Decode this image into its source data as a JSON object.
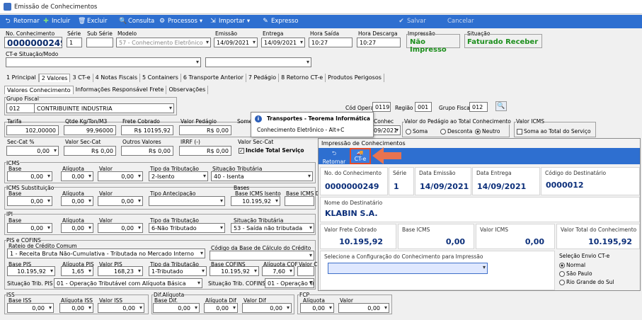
{
  "window": {
    "title": "Emissão de Conhecimentos"
  },
  "toolbar": {
    "retornar": "Retornar",
    "incluir": "Incluir",
    "excluir": "Excluir",
    "consulta": "Consulta",
    "processos": "Processos",
    "importar": "Importar",
    "expresso": "Expresso",
    "salvar": "Salvar",
    "cancelar": "Cancelar"
  },
  "header": {
    "no_conhecimento_label": "No. Conhecimento",
    "no_conhecimento": "0000000249",
    "serie_label": "Série",
    "serie": "1",
    "subserie_label": "Sub Série",
    "subserie": "",
    "modelo_label": "Modelo",
    "modelo": "57 - Conhecimento Eletrônico",
    "emissao_label": "Emissão",
    "emissao": "14/09/2021",
    "entrega_label": "Entrega",
    "entrega": "14/09/2021",
    "hora_saida_label": "Hora Saída",
    "hora_saida": "10:27",
    "hora_descarga_label": "Hora Descarga",
    "hora_descarga": "10:27",
    "impressao_label": "Impressão",
    "impressao": "Não Impresso",
    "situacao_label": "Situação",
    "situacao": "Faturado Receber",
    "cte_sit_label": "CT-e Situação/Modo"
  },
  "tabs": [
    "1 Principal",
    "2 Valores",
    "3 CT-e",
    "4 Notas Fiscais",
    "5 Containers",
    "6 Transporte Anterior",
    "7 Pedágio",
    "8 Retorno CT-e",
    "Produtos Perigosos"
  ],
  "subtabs": [
    "Valores Conhecimento",
    "Informações Responsável Frete",
    "Observações"
  ],
  "grupo": {
    "label": "Grupo Fiscal",
    "code": "012",
    "name": "CONTRIBUINTE INDUSTRIA",
    "cfo_label": "Cód Operação",
    "cfo": "0119",
    "regiao_label": "Região",
    "regiao": "001",
    "gf_label": "Grupo Fiscal",
    "gf": "012"
  },
  "valores": {
    "tarifa_label": "Tarifa",
    "tarifa": "102,00000",
    "qtde_label": "Qtde Kg/Ton/M3",
    "qtde": "99,96000",
    "frete_label": "Frete Cobrado",
    "frete": "R$ 10195,92",
    "pedagio_label": "Valor Pedágio",
    "pedagio": "R$ 0,00",
    "soma_label": "Some",
    "conhec_label": "Conhec",
    "conhec_date": "09/2021",
    "vpt_label": "Valor do Pedágio ao Total Conhecimento",
    "soma_opt": "Soma",
    "desconta_opt": "Desconta",
    "neutro_opt": "Neutro",
    "vicms_label": "Valor ICMS",
    "soma_total_opt": "Soma ao Total do Serviço",
    "seccat_label": "Sec-Cat %",
    "seccat": "0,00",
    "vsec_label": "Valor Sec-Cat",
    "vsec": "R$ 0,00",
    "outros_label": "Outros Valores",
    "outros": "R$ 0,00",
    "irrf_label": "IRRF (-)",
    "irrf": "R$ 0,00",
    "vsec2_label": "Valor Sec-Cat",
    "incide_label": "Incide Total Serviço"
  },
  "icms": {
    "title": "ICMS",
    "base_label": "Base",
    "base": "0,00",
    "aliq_label": "Alíquota",
    "aliq": "0,00",
    "valor_label": "Valor",
    "valor": "0,00",
    "trib_label": "Tipo da Tributação",
    "trib": "2-Isento",
    "sit_label": "Situação Tributária",
    "sit": "40 - Isenta"
  },
  "icms_st": {
    "title": "ICMS Substituição",
    "base_label": "Base",
    "base": "0,00",
    "aliq_label": "Alíquota",
    "aliq": "0,00",
    "valor_label": "Valor",
    "valor": "0,00",
    "antec_label": "Tipo Antecipação",
    "bases_label": "Bases",
    "isento_label": "Base ICMS Isento",
    "isento": "10.195,92",
    "def_label": "Base ICMS D"
  },
  "ipi": {
    "title": "IPI",
    "base_label": "Base",
    "base": "0,00",
    "aliq_label": "Alíquota",
    "aliq": "0,00",
    "valor_label": "Valor",
    "valor": "0,00",
    "trib_label": "Tipo da Tributação",
    "trib": "6-Não Tributado",
    "sit_label": "Situação Tributária",
    "sit": "53 - Saída não tributada"
  },
  "pis": {
    "title": "PIS e COFINS",
    "rateio_label": "Rateio de Crédito Comum",
    "rateio": "1 - Receita Bruta Não-Cumulativa - Tributada no Mercado Interno",
    "cod_base_label": "Código da Base de Cálculo do Crédito",
    "base_label": "Base PIS",
    "base": "10.195,92",
    "aliq_label": "Alíquota PIS",
    "aliq": "1,65",
    "valor_label": "Valor PIS",
    "valor": "168,23",
    "trib_label": "Tipo da Tributação",
    "trib": "1-Tributado",
    "bcof_label": "Base COFINS",
    "bcof": "10.195,92",
    "acof_label": "Alíquota COF",
    "acof": "7,60",
    "vcof_label": "Valor C",
    "sit_pis_label": "Situação Trib. PIS",
    "sit_pis": "01 - Operação Tributável com Alíquota Básica",
    "sit_cof_label": "Situação Trib. COFINS",
    "sit_cof": "01 - Operação Tr"
  },
  "iss": {
    "title": "ISS",
    "base_label": "Base ISS",
    "base": "0,00",
    "aliq_label": "Alíquota ISS",
    "aliq": "0,00",
    "valor_label": "Valor ISS",
    "valor": "0,00",
    "dif_title": "Dif.Alíquota",
    "bdif_label": "Base Dif.",
    "bdif": "0,00",
    "adif_label": "Alíquota Dif",
    "adif": "0,00",
    "vdif_label": "Valor Dif",
    "vdif": "0,00"
  },
  "fcp": {
    "title": "FCP",
    "aliq_label": "Alíquota",
    "aliq": "0,00",
    "valor_label": "Valor",
    "valor": "0,00"
  },
  "tooltip": {
    "title": "Transportes - Teorema Informática",
    "text": "Conhecimento Eletrônico - Alt+C"
  },
  "dialog": {
    "title": "Impressão de Conhecimentos",
    "retornar": "Retornar",
    "cte": "CT-e",
    "no_label": "No. do Conhecimento",
    "no": "0000000249",
    "serie_label": "Série",
    "serie": "1",
    "emissao_label": "Data Emissão",
    "emissao": "14/09/2021",
    "entrega_label": "Data Entrega",
    "entrega": "14/09/2021",
    "dest_code_label": "Código do Destinatário",
    "dest_code": "0000012",
    "dest_name_label": "Nome do Destinatário",
    "dest_name": "KLABIN S.A.",
    "frete_label": "Valor Frete Cobrado",
    "frete": "10.195,92",
    "bicms_label": "Base ICMS",
    "bicms": "0,00",
    "vicms_label": "Valor ICMS",
    "vicms": "0,00",
    "total_label": "Valor Total do Conhecimento",
    "total": "10.195,92",
    "config_label": "Selecione a Configuração do Conhecimento para Impressão",
    "envio_label": "Seleção Envio CT-e",
    "envio_opts": [
      "Normal",
      "São Paulo",
      "Rio Grande do Sul"
    ]
  }
}
